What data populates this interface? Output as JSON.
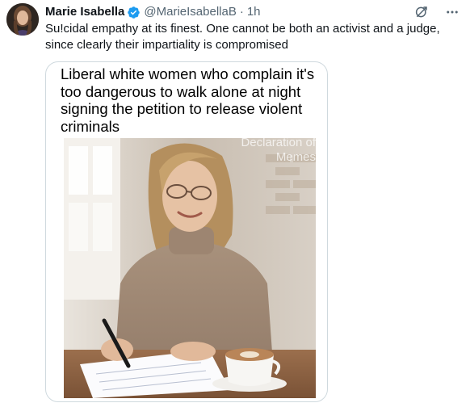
{
  "tweet": {
    "author_name": "Marie Isabella",
    "author_handle": "@MarieIsabellaB",
    "separator": "·",
    "time": "1h",
    "text": "Su!cidal empathy at its finest. One cannot be both an activist and a judge, since clearly their impartiality is compromised",
    "verified": true
  },
  "media": {
    "caption": "Liberal white women who complain it's too dangerous to walk alone at night signing the petition to release violent criminals",
    "watermark": "Declaration of Memes"
  },
  "icons": {
    "verified": "verified-badge-icon",
    "grok": "grok-icon",
    "more": "more-options-icon"
  },
  "colors": {
    "verified_blue": "#1d9bf0",
    "secondary_text": "#536471",
    "border": "#cfd9de"
  }
}
